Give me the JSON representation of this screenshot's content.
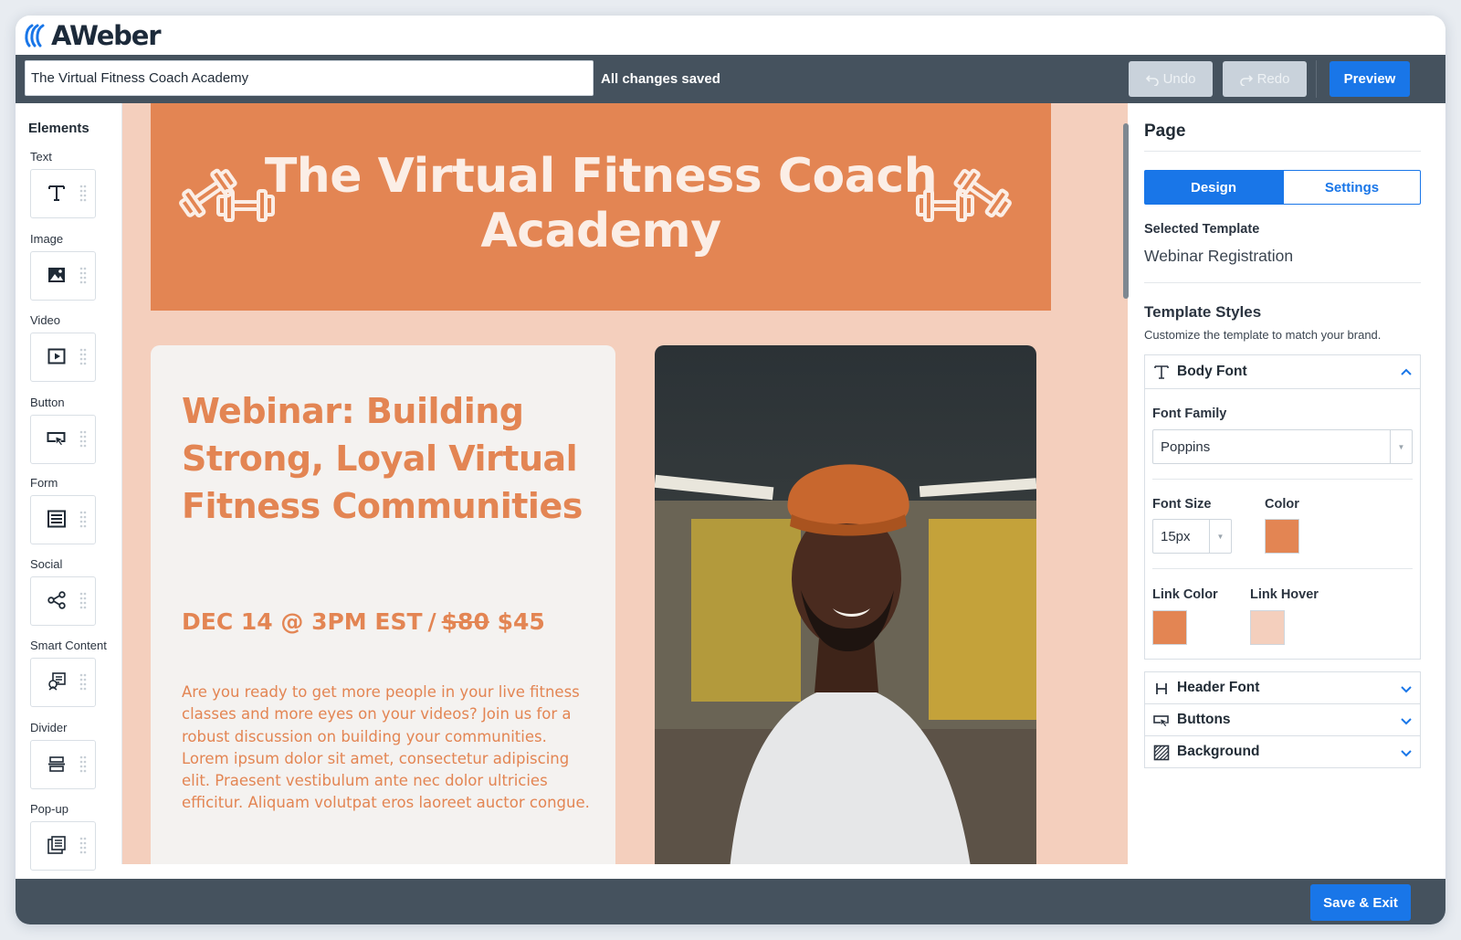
{
  "brand": {
    "name": "AWeber"
  },
  "toolbar": {
    "page_name": "The Virtual Fitness Coach Academy",
    "status": "All changes saved",
    "undo_label": "Undo",
    "redo_label": "Redo",
    "preview_label": "Preview"
  },
  "elements": {
    "title": "Elements",
    "items": [
      {
        "label": "Text",
        "icon": "text-icon"
      },
      {
        "label": "Image",
        "icon": "image-icon"
      },
      {
        "label": "Video",
        "icon": "video-icon"
      },
      {
        "label": "Button",
        "icon": "button-icon"
      },
      {
        "label": "Form",
        "icon": "form-icon"
      },
      {
        "label": "Social",
        "icon": "share-icon"
      },
      {
        "label": "Smart Content",
        "icon": "smart-content-icon"
      },
      {
        "label": "Divider",
        "icon": "divider-icon"
      },
      {
        "label": "Pop-up",
        "icon": "popup-icon"
      }
    ]
  },
  "canvas": {
    "hero_title": "The Virtual Fitness Coach Academy",
    "webinar_title": "Webinar: Building Strong, Loyal Virtual Fitness Communities",
    "date": "DEC 14 @ 3PM EST",
    "separator": "/",
    "old_price": "$80",
    "new_price": "$45",
    "body": "Are you ready to get more people in your live fitness classes and more eyes on your videos? Join us for a robust discussion on building your communities. Lorem ipsum dolor sit amet, consectetur adipiscing elit. Praesent vestibulum ante nec dolor ultricies efficitur. Aliquam volutpat eros laoreet auctor congue."
  },
  "panel": {
    "title": "Page",
    "tabs": [
      "Design",
      "Settings"
    ],
    "selected_template_label": "Selected Template",
    "selected_template_value": "Webinar Registration",
    "styles_title": "Template Styles",
    "styles_subtitle": "Customize the template to match your brand.",
    "body_font": {
      "header": "Body Font",
      "font_family_label": "Font Family",
      "font_family_value": "Poppins",
      "font_size_label": "Font Size",
      "font_size_value": "15px",
      "color_label": "Color",
      "link_color_label": "Link Color",
      "link_hover_label": "Link Hover"
    },
    "sections": [
      "Header Font",
      "Buttons",
      "Background"
    ]
  },
  "bottom": {
    "save_label": "Save & Exit"
  },
  "colors": {
    "accent": "#1976e8",
    "brand_orange": "#e38553",
    "peach": "#f4cfbd",
    "toolbar": "#45525e",
    "body_color": "#e38553",
    "link_color": "#e38553",
    "link_hover": "#f4cfbd"
  }
}
